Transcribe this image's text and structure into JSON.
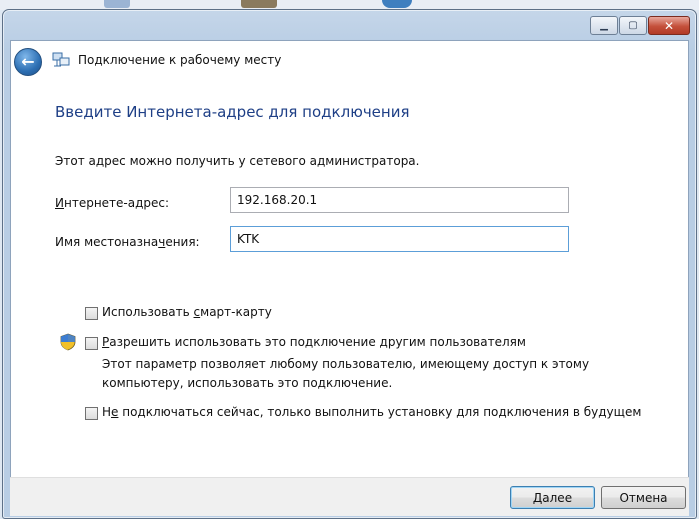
{
  "window": {
    "title": "Подключение к рабочему месту",
    "controls": {
      "minimize_icon": "minimize-icon",
      "maximize_icon": "maximize-icon",
      "close_icon": "close-icon"
    }
  },
  "nav": {
    "back_icon": "back-arrow-icon"
  },
  "page": {
    "heading": "Введите Интернета-адрес для подключения",
    "description": "Этот адрес можно получить у сетевого администратора."
  },
  "fields": {
    "address": {
      "label_pre": "",
      "label_accel": "И",
      "label_post": "нтернете-адрес:",
      "value": "192.168.20.1"
    },
    "destination": {
      "label_pre": "Имя местоназна",
      "label_accel": "ч",
      "label_post": "ения:",
      "value": "KTK"
    }
  },
  "options": {
    "smartcard": {
      "label_pre": "Использовать ",
      "label_accel": "с",
      "label_post": "март-карту",
      "checked": false
    },
    "allow_others": {
      "label_pre": "",
      "label_accel": "Р",
      "label_post": "азрешить использовать это подключение другим пользователям",
      "checked": false,
      "note": "Этот параметр позволяет любому пользователю, имеющему доступ к этому компьютеру, использовать это подключение.",
      "shield_icon": "uac-shield-icon"
    },
    "connect_later": {
      "label_pre": "Н",
      "label_accel": "е",
      "label_post": " подключаться сейчас, только выполнить установку для подключения в будущем",
      "checked": false
    }
  },
  "buttons": {
    "next": {
      "label_pre": "",
      "label_accel": "Д",
      "label_post": "алее"
    },
    "cancel": {
      "label": "Отмена"
    }
  },
  "colors": {
    "heading": "#1e3f86",
    "titlebar": "#b8cde4",
    "focus_border": "#5c9ed8"
  }
}
